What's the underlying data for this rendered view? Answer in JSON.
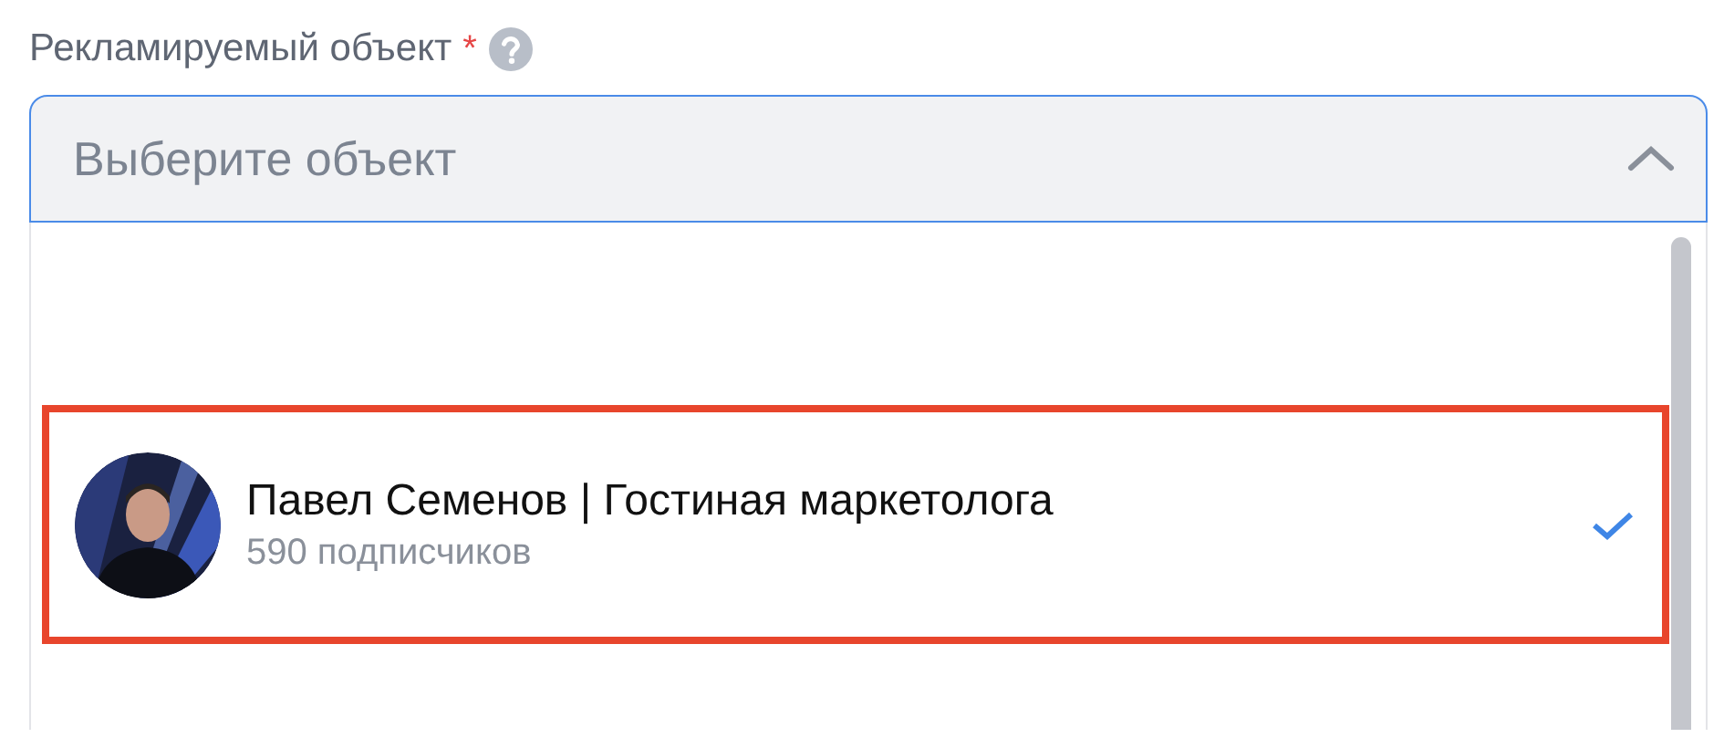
{
  "field": {
    "label": "Рекламируемый объект",
    "required_mark": "*",
    "placeholder": "Выберите объект",
    "expanded": true
  },
  "options": [
    {
      "kind": "picture",
      "title": "Павел Семенов | Гостиная маркетолога",
      "subtitle": "590 подписчиков",
      "selected": true,
      "highlighted": true
    }
  ]
}
